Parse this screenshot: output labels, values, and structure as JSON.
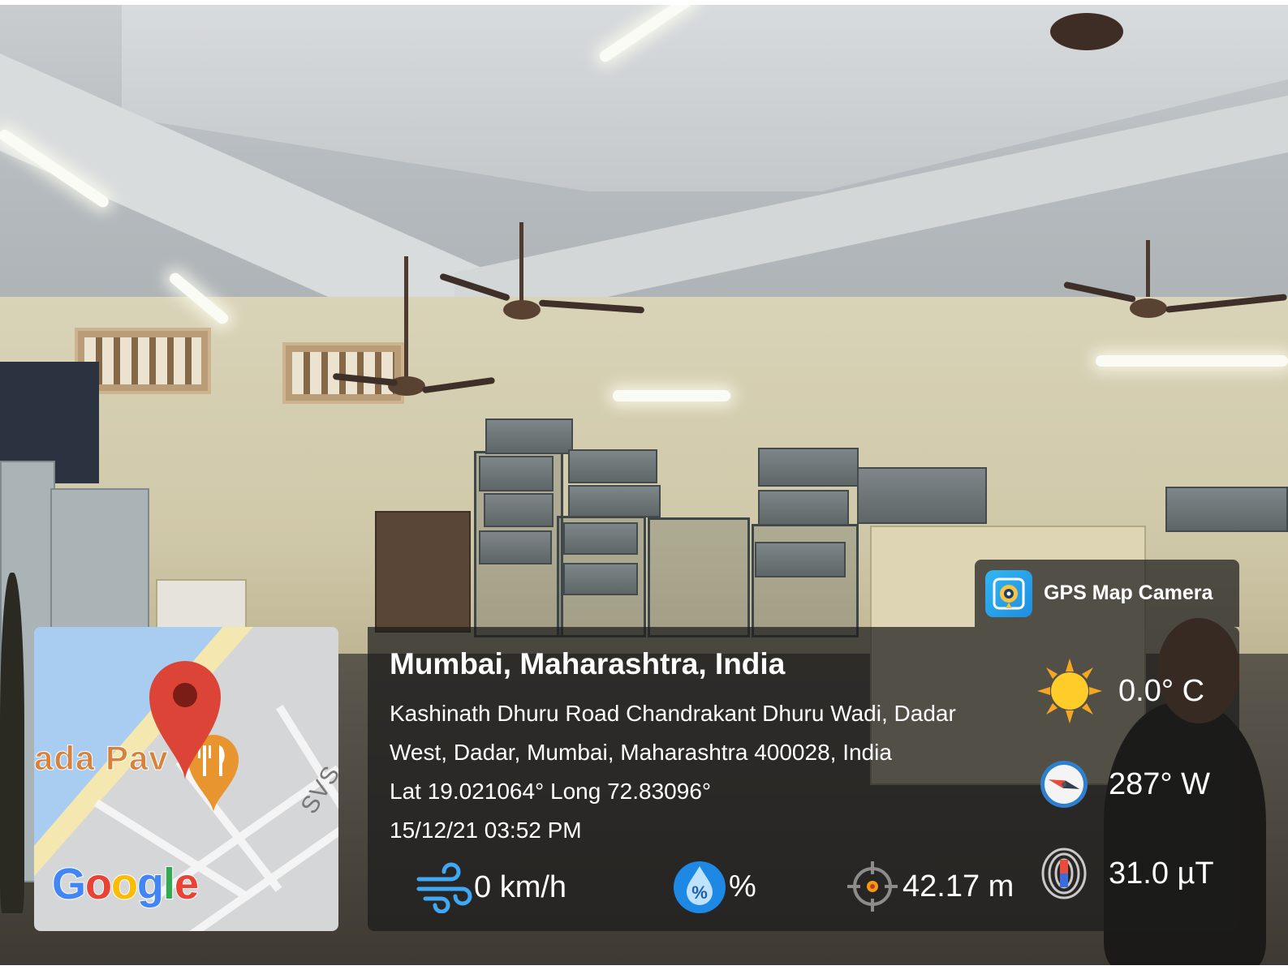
{
  "brand": {
    "name": "GPS Map Camera",
    "icon": "gps-map-camera-app-icon"
  },
  "location": {
    "title": "Mumbai, Maharashtra, India",
    "address_line1": "Kashinath Dhuru Road Chandrakant Dhuru Wadi, Dadar",
    "address_line2": "West, Dadar, Mumbai, Maharashtra 400028, India",
    "coordinates": "Lat 19.021064° Long 72.83096°",
    "datetime": "15/12/21 03:52 PM"
  },
  "map": {
    "place_label": "ada Pav",
    "road_label": "SVS",
    "logo": "Google",
    "logo_colors": [
      "#4285f4",
      "#ea4335",
      "#fbbc05",
      "#4285f4",
      "#34a853",
      "#ea4335"
    ],
    "pin_color": "#db4437",
    "food_pin_color": "#e8952f"
  },
  "weather": {
    "wind": {
      "icon": "wind-icon",
      "value": "0 km/h"
    },
    "humidity": {
      "icon": "humidity-icon",
      "value": "%"
    },
    "altitude": {
      "icon": "altitude-target-icon",
      "value": "42.17 m"
    },
    "temperature": {
      "icon": "sun-icon",
      "value": "0.0° C"
    },
    "heading": {
      "icon": "compass-icon",
      "value": "287° W"
    },
    "magnetic": {
      "icon": "magnetic-field-icon",
      "value": "31.0 µT"
    }
  }
}
